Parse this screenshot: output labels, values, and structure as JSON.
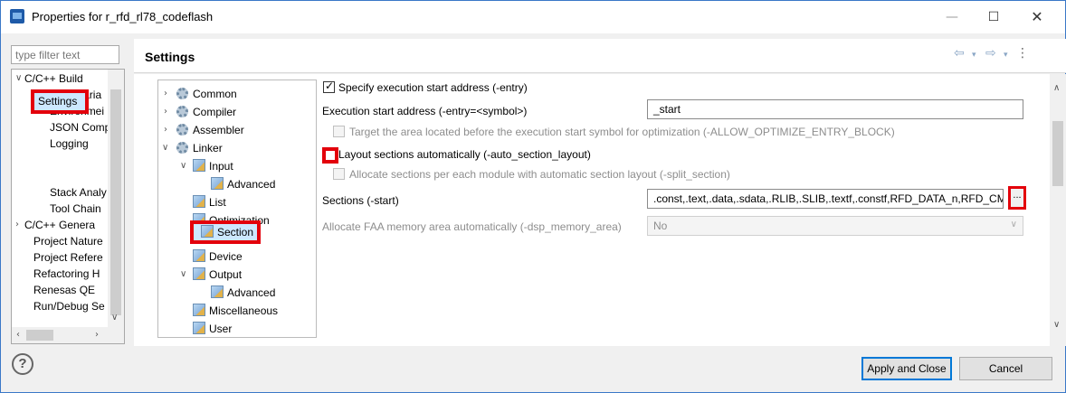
{
  "window": {
    "title": "Properties for r_rfd_rl78_codeflash",
    "minimize": "—",
    "maximize": "☐",
    "close": "✕"
  },
  "filter": {
    "placeholder": "type filter text"
  },
  "left_tree": {
    "items": [
      {
        "label": "C/C++ Build",
        "expanded": true
      },
      {
        "label": "Build Varia"
      },
      {
        "label": "Environmei"
      },
      {
        "label": "JSON Comp"
      },
      {
        "label": "Logging"
      },
      {
        "label": "Settings",
        "selected": true
      },
      {
        "label": "Stack Analy"
      },
      {
        "label": "Tool Chain"
      },
      {
        "label": "C/C++ Genera",
        "expanded": false
      },
      {
        "label": "Project Nature"
      },
      {
        "label": "Project Refere"
      },
      {
        "label": "Refactoring H"
      },
      {
        "label": "Renesas QE"
      },
      {
        "label": "Run/Debug Se"
      }
    ]
  },
  "header": {
    "title": "Settings"
  },
  "tool_tree": {
    "items": [
      {
        "label": "Common"
      },
      {
        "label": "Compiler"
      },
      {
        "label": "Assembler"
      },
      {
        "label": "Linker"
      },
      {
        "label": "Input"
      },
      {
        "label": "Advanced"
      },
      {
        "label": "List"
      },
      {
        "label": "Optimization"
      },
      {
        "label": "Section",
        "selected": true
      },
      {
        "label": "Device"
      },
      {
        "label": "Output"
      },
      {
        "label": "Advanced"
      },
      {
        "label": "Miscellaneous"
      },
      {
        "label": "User"
      }
    ]
  },
  "settings": {
    "entry_checkbox": "Specify execution start address (-entry)",
    "entry_label": "Execution start address (-entry=<symbol>)",
    "entry_value": "_start",
    "optimize_entry": "Target the area located before the execution start symbol for optimization (-ALLOW_OPTIMIZE_ENTRY_BLOCK)",
    "auto_section": "Layout sections automatically (-auto_section_layout)",
    "split_section": "Allocate sections per each module with automatic section layout (-split_section)",
    "sections_label": "Sections (-start)",
    "sections_value": ".const,.text,.data,.sdata,.RLIB,.SLIB,.textf,.constf,RFD_DATA_n,RFD_CM",
    "sections_button": "...",
    "faa_label": "Allocate FAA memory area automatically (-dsp_memory_area)",
    "faa_value": "No"
  },
  "footer": {
    "help": "?",
    "apply_close": "Apply and Close",
    "cancel": "Cancel"
  },
  "colors": {
    "highlight": "#e3000b",
    "selection": "#cde8ff"
  }
}
